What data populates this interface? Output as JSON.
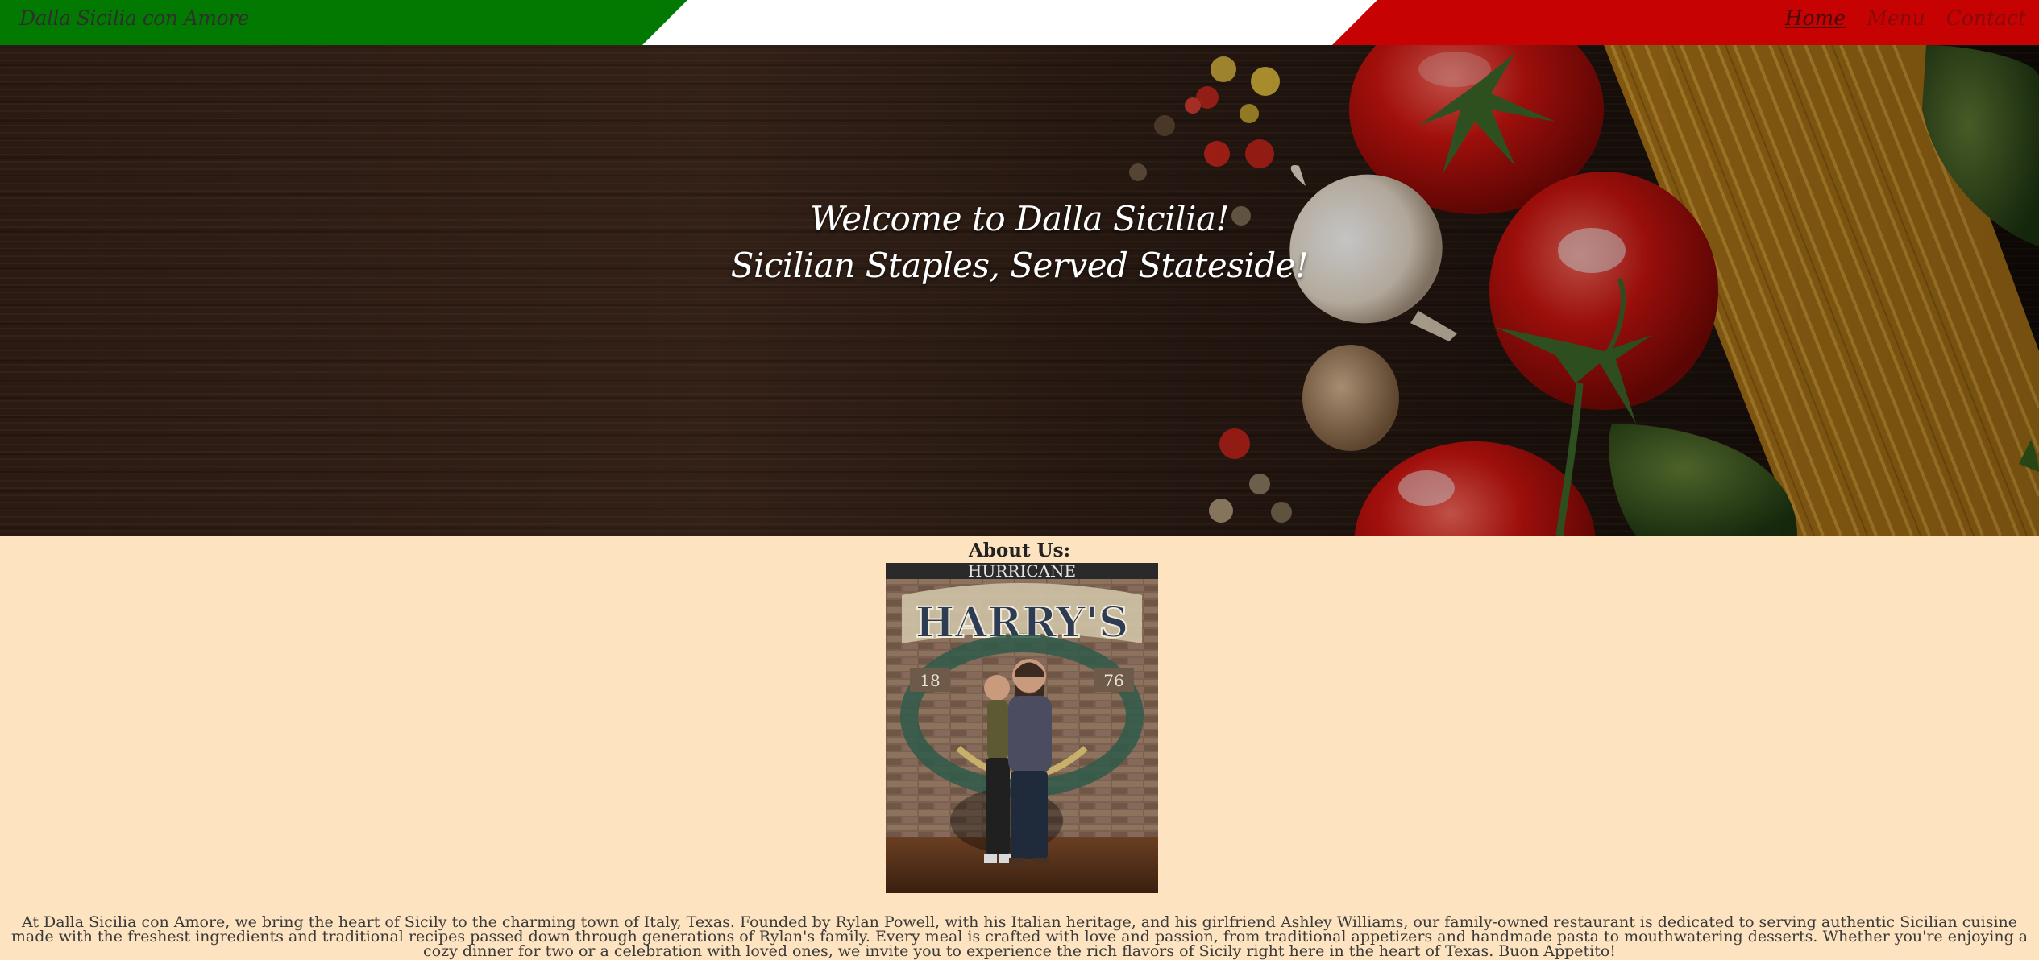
{
  "header": {
    "brand": "Dalla Sicilia con Amore",
    "nav": [
      {
        "label": "Home",
        "active": true
      },
      {
        "label": "Menu",
        "active": false
      },
      {
        "label": "Contact",
        "active": false
      }
    ],
    "colors": {
      "green": "#027a02",
      "white": "#ffffff",
      "red": "#c70202"
    }
  },
  "hero": {
    "line1": "Welcome to Dalla Sicilia!",
    "line2": "Sicilian Staples, Served Stateside!"
  },
  "about": {
    "title": "About Us:",
    "photo": {
      "sign_top": "HURRICANE",
      "sign_name": "HARRY'S",
      "sign_left": "18",
      "sign_right": "76"
    },
    "text": "At Dalla Sicilia con Amore, we bring the heart of Sicily to the charming town of Italy, Texas. Founded by Rylan Powell, with his Italian heritage, and his girlfriend Ashley Williams, our family-owned restaurant is dedicated to serving authentic Sicilian cuisine made with the freshest ingredients and traditional recipes passed down through generations of Rylan's family. Every meal is crafted with love and passion, from traditional appetizers and handmade pasta to mouthwatering desserts. Whether you're enjoying a cozy dinner for two or a celebration with loved ones, we invite you to experience the rich flavors of Sicily right here in the heart of Texas. Buon Appetito!"
  }
}
